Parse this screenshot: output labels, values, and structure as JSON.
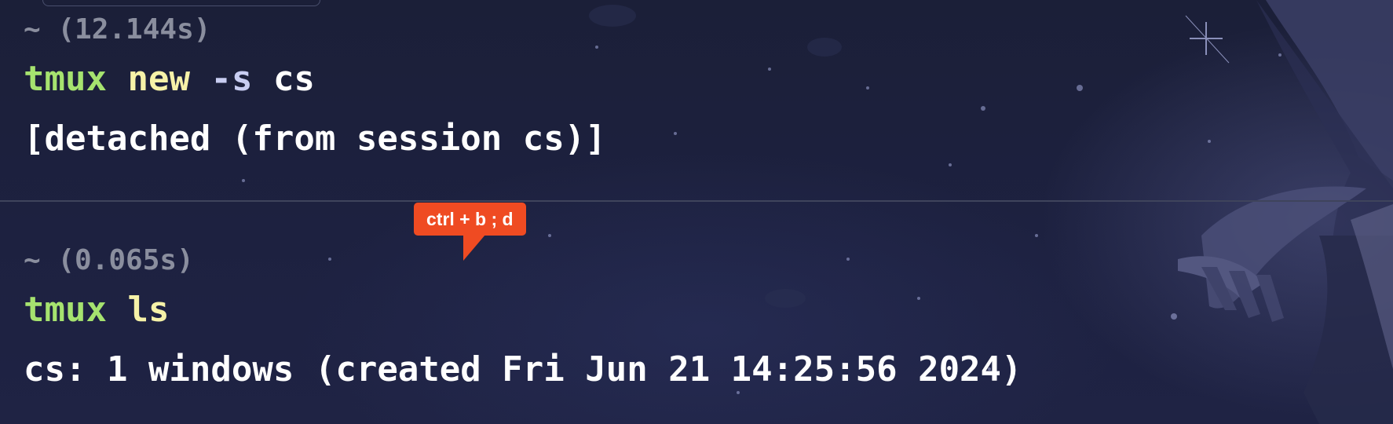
{
  "session_one": {
    "timing": "~ (12.144s)",
    "command": {
      "program": "tmux",
      "subcommand": "new",
      "flag": "-s",
      "value": "cs"
    },
    "output": "[detached (from session cs)]"
  },
  "annotation": {
    "label": "ctrl + b ; d",
    "color": "#ef4b22"
  },
  "session_two": {
    "timing": "~ (0.065s)",
    "command": {
      "program": "tmux",
      "subcommand": "ls"
    },
    "output": "cs: 1 windows (created Fri Jun 21 14:25:56 2024)"
  },
  "colors": {
    "background": "#1d2140",
    "program": "#a6e36f",
    "subcommand": "#f6f2a8",
    "flag": "#c8cdf2",
    "timing": "#8a8e9e",
    "output": "#ffffff"
  }
}
